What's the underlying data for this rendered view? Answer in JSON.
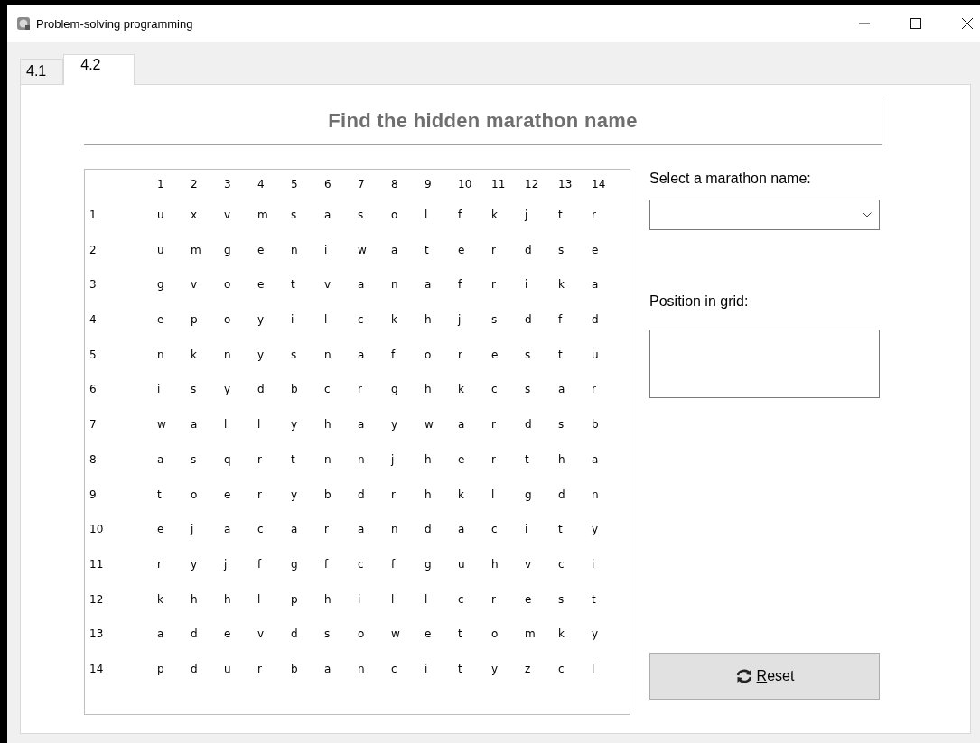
{
  "window": {
    "title": "Problem-solving programming"
  },
  "tabs": [
    {
      "label": "4.1",
      "selected": false
    },
    {
      "label": "4.2",
      "selected": true
    }
  ],
  "heading": "Find the hidden marathon name",
  "grid": {
    "column_headers": [
      "1",
      "2",
      "3",
      "4",
      "5",
      "6",
      "7",
      "8",
      "9",
      "10",
      "11",
      "12",
      "13",
      "14"
    ],
    "rows": [
      {
        "label": "1",
        "letters": [
          "u",
          "x",
          "v",
          "m",
          "s",
          "a",
          "s",
          "o",
          "l",
          "f",
          "k",
          "j",
          "t",
          "r"
        ]
      },
      {
        "label": "2",
        "letters": [
          "u",
          "m",
          "g",
          "e",
          "n",
          "i",
          "w",
          "a",
          "t",
          "e",
          "r",
          "d",
          "s",
          "e"
        ]
      },
      {
        "label": "3",
        "letters": [
          "g",
          "v",
          "o",
          "e",
          "t",
          "v",
          "a",
          "n",
          "a",
          "f",
          "r",
          "i",
          "k",
          "a"
        ]
      },
      {
        "label": "4",
        "letters": [
          "e",
          "p",
          "o",
          "y",
          "i",
          "l",
          "c",
          "k",
          "h",
          "j",
          "s",
          "d",
          "f",
          "d"
        ]
      },
      {
        "label": "5",
        "letters": [
          "n",
          "k",
          "n",
          "y",
          "s",
          "n",
          "a",
          "f",
          "o",
          "r",
          "e",
          "s",
          "t",
          "u"
        ]
      },
      {
        "label": "6",
        "letters": [
          "i",
          "s",
          "y",
          "d",
          "b",
          "c",
          "r",
          "g",
          "h",
          "k",
          "c",
          "s",
          "a",
          "r"
        ]
      },
      {
        "label": "7",
        "letters": [
          "w",
          "a",
          "l",
          "l",
          "y",
          "h",
          "a",
          "y",
          "w",
          "a",
          "r",
          "d",
          "s",
          "b"
        ]
      },
      {
        "label": "8",
        "letters": [
          "a",
          "s",
          "q",
          "r",
          "t",
          "n",
          "n",
          "j",
          "h",
          "e",
          "r",
          "t",
          "h",
          "a"
        ]
      },
      {
        "label": "9",
        "letters": [
          "t",
          "o",
          "e",
          "r",
          "y",
          "b",
          "d",
          "r",
          "h",
          "k",
          "l",
          "g",
          "d",
          "n"
        ]
      },
      {
        "label": "10",
        "letters": [
          "e",
          "j",
          "a",
          "c",
          "a",
          "r",
          "a",
          "n",
          "d",
          "a",
          "c",
          "i",
          "t",
          "y"
        ]
      },
      {
        "label": "11",
        "letters": [
          "r",
          "y",
          "j",
          "f",
          "g",
          "f",
          "c",
          "f",
          "g",
          "u",
          "h",
          "v",
          "c",
          "i"
        ]
      },
      {
        "label": "12",
        "letters": [
          "k",
          "h",
          "h",
          "l",
          "p",
          "h",
          "i",
          "l",
          "l",
          "c",
          "r",
          "e",
          "s",
          "t"
        ]
      },
      {
        "label": "13",
        "letters": [
          "a",
          "d",
          "e",
          "v",
          "d",
          "s",
          "o",
          "w",
          "e",
          "t",
          "o",
          "m",
          "k",
          "y"
        ]
      },
      {
        "label": "14",
        "letters": [
          "p",
          "d",
          "u",
          "r",
          "b",
          "a",
          "n",
          "c",
          "i",
          "t",
          "y",
          "z",
          "c",
          "l"
        ]
      }
    ]
  },
  "marathon_select": {
    "label": "Select a marathon name:"
  },
  "position": {
    "label": "Position in grid:"
  },
  "reset_button": {
    "label": "Reset",
    "access_key_underlined": true
  }
}
